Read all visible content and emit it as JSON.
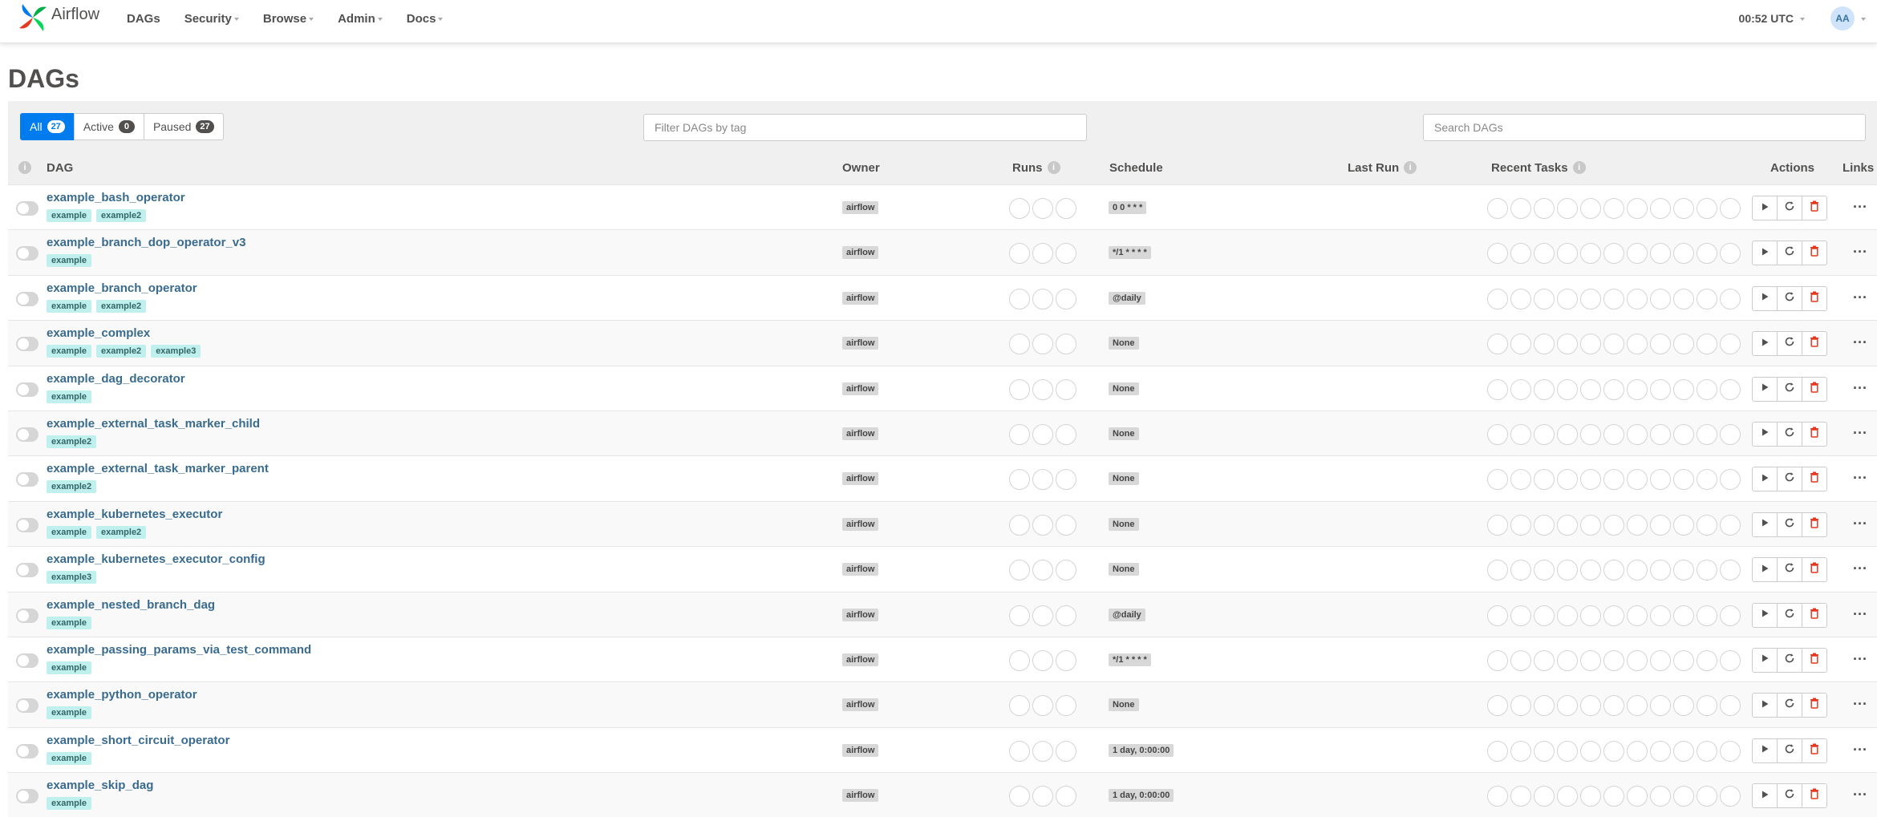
{
  "navbar": {
    "brand": "Airflow",
    "menu": [
      "DAGs",
      "Security",
      "Browse",
      "Admin",
      "Docs"
    ],
    "clock": "00:52 UTC",
    "avatar": "AA"
  },
  "page": {
    "title": "DAGs"
  },
  "filters": {
    "all_label": "All",
    "all_count": "27",
    "active_label": "Active",
    "active_count": "0",
    "paused_label": "Paused",
    "paused_count": "27",
    "tag_placeholder": "Filter DAGs by tag",
    "search_placeholder": "Search DAGs"
  },
  "columns": {
    "dag": "DAG",
    "owner": "Owner",
    "runs": "Runs",
    "schedule": "Schedule",
    "last_run": "Last Run",
    "recent_tasks": "Recent Tasks",
    "actions": "Actions",
    "links": "Links",
    "info_glyph": "i"
  },
  "dags": [
    {
      "name": "example_bash_operator",
      "tags": [
        "example",
        "example2"
      ],
      "owner": "airflow",
      "schedule": "0 0 * * *"
    },
    {
      "name": "example_branch_dop_operator_v3",
      "tags": [
        "example"
      ],
      "owner": "airflow",
      "schedule": "*/1 * * * *"
    },
    {
      "name": "example_branch_operator",
      "tags": [
        "example",
        "example2"
      ],
      "owner": "airflow",
      "schedule": "@daily"
    },
    {
      "name": "example_complex",
      "tags": [
        "example",
        "example2",
        "example3"
      ],
      "owner": "airflow",
      "schedule": "None"
    },
    {
      "name": "example_dag_decorator",
      "tags": [
        "example"
      ],
      "owner": "airflow",
      "schedule": "None"
    },
    {
      "name": "example_external_task_marker_child",
      "tags": [
        "example2"
      ],
      "owner": "airflow",
      "schedule": "None"
    },
    {
      "name": "example_external_task_marker_parent",
      "tags": [
        "example2"
      ],
      "owner": "airflow",
      "schedule": "None"
    },
    {
      "name": "example_kubernetes_executor",
      "tags": [
        "example",
        "example2"
      ],
      "owner": "airflow",
      "schedule": "None"
    },
    {
      "name": "example_kubernetes_executor_config",
      "tags": [
        "example3"
      ],
      "owner": "airflow",
      "schedule": "None"
    },
    {
      "name": "example_nested_branch_dag",
      "tags": [
        "example"
      ],
      "owner": "airflow",
      "schedule": "@daily"
    },
    {
      "name": "example_passing_params_via_test_command",
      "tags": [
        "example"
      ],
      "owner": "airflow",
      "schedule": "*/1 * * * *"
    },
    {
      "name": "example_python_operator",
      "tags": [
        "example"
      ],
      "owner": "airflow",
      "schedule": "None"
    },
    {
      "name": "example_short_circuit_operator",
      "tags": [
        "example"
      ],
      "owner": "airflow",
      "schedule": "1 day, 0:00:00"
    },
    {
      "name": "example_skip_dag",
      "tags": [
        "example"
      ],
      "owner": "airflow",
      "schedule": "1 day, 0:00:00"
    }
  ],
  "run_circle_count": 3,
  "recent_task_circle_count": 11,
  "links_glyph": "···",
  "icons": {
    "trigger": "play-icon",
    "refresh": "refresh-icon",
    "delete": "trash-icon"
  },
  "colors": {
    "primary": "#017cee",
    "link": "#396b8f",
    "tag_bg": "#bff0ee",
    "delete": "#e43921"
  }
}
